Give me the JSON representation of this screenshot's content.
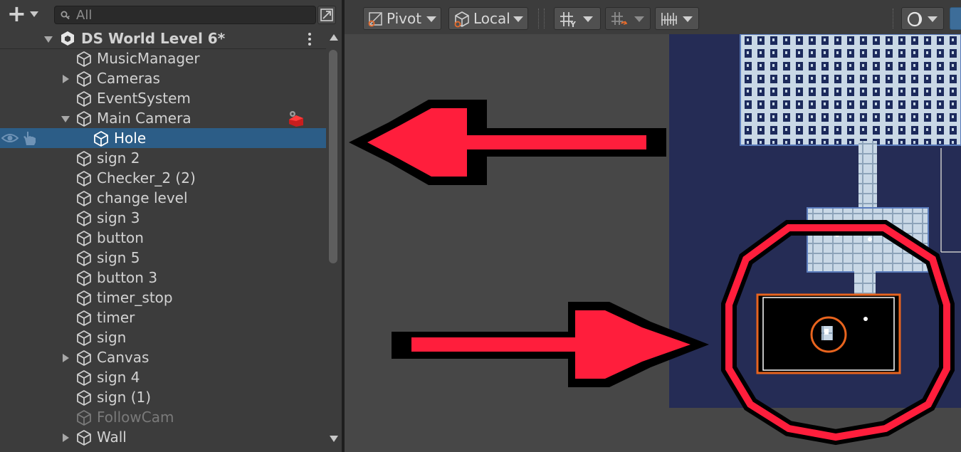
{
  "hierarchy": {
    "search": {
      "placeholder": "All",
      "value": ""
    },
    "scene_name": "DS World Level 6*",
    "items": [
      {
        "label": "MusicManager",
        "indent": 1,
        "foldout": "none"
      },
      {
        "label": "Cameras",
        "indent": 1,
        "foldout": "collapsed"
      },
      {
        "label": "EventSystem",
        "indent": 1,
        "foldout": "none"
      },
      {
        "label": "Main Camera",
        "indent": 1,
        "foldout": "expanded"
      },
      {
        "label": "Hole",
        "indent": 2,
        "foldout": "none",
        "selected": true
      },
      {
        "label": "sign 2",
        "indent": 1,
        "foldout": "none"
      },
      {
        "label": "Checker_2 (2)",
        "indent": 1,
        "foldout": "none"
      },
      {
        "label": "change level",
        "indent": 1,
        "foldout": "none"
      },
      {
        "label": "sign 3",
        "indent": 1,
        "foldout": "none"
      },
      {
        "label": "button",
        "indent": 1,
        "foldout": "none"
      },
      {
        "label": "sign 5",
        "indent": 1,
        "foldout": "none"
      },
      {
        "label": "button 3",
        "indent": 1,
        "foldout": "none"
      },
      {
        "label": "timer_stop",
        "indent": 1,
        "foldout": "none"
      },
      {
        "label": "timer",
        "indent": 1,
        "foldout": "none"
      },
      {
        "label": "sign",
        "indent": 1,
        "foldout": "none"
      },
      {
        "label": "Canvas",
        "indent": 1,
        "foldout": "collapsed"
      },
      {
        "label": "sign 4",
        "indent": 1,
        "foldout": "none"
      },
      {
        "label": "sign (1)",
        "indent": 1,
        "foldout": "none"
      },
      {
        "label": "FollowCam",
        "indent": 1,
        "foldout": "none",
        "disabled": true
      },
      {
        "label": "Wall",
        "indent": 1,
        "foldout": "collapsed"
      }
    ]
  },
  "scene_toolbar": {
    "pivot_label": "Pivot",
    "space_label": "Local"
  },
  "colors": {
    "selection": "#2c5d87",
    "annotation_red": "#ff1e3c",
    "camera_gizmo_orange": "#e8641e",
    "scene_background": "#252c55",
    "tile": "#c9d8e6"
  },
  "icons": [
    "plus-icon",
    "search-icon",
    "unity-scene-icon",
    "gameobject-cube-icon",
    "eye-icon",
    "hand-icon",
    "camera-badge-icon",
    "pivot-icon",
    "local-icon",
    "grid-snap-icon",
    "increment-snap-icon",
    "ruler-icon",
    "shading-mode-icon"
  ]
}
